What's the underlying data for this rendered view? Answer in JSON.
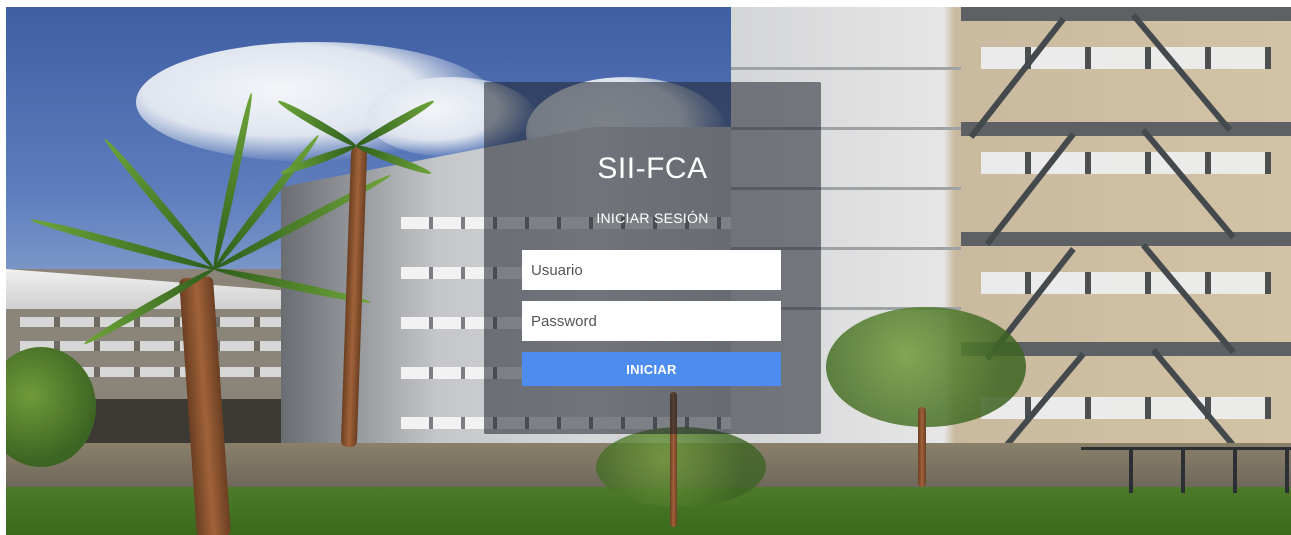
{
  "login": {
    "title": "SII-FCA",
    "subtitle": "INICIAR SESIÓN",
    "username_placeholder": "Usuario",
    "password_placeholder": "Password",
    "submit_label": "INICIAR"
  },
  "colors": {
    "panel_overlay": "#1e222c",
    "button": "#4d8df0",
    "input_background": "#ffffff",
    "title_text": "#ffffff"
  }
}
